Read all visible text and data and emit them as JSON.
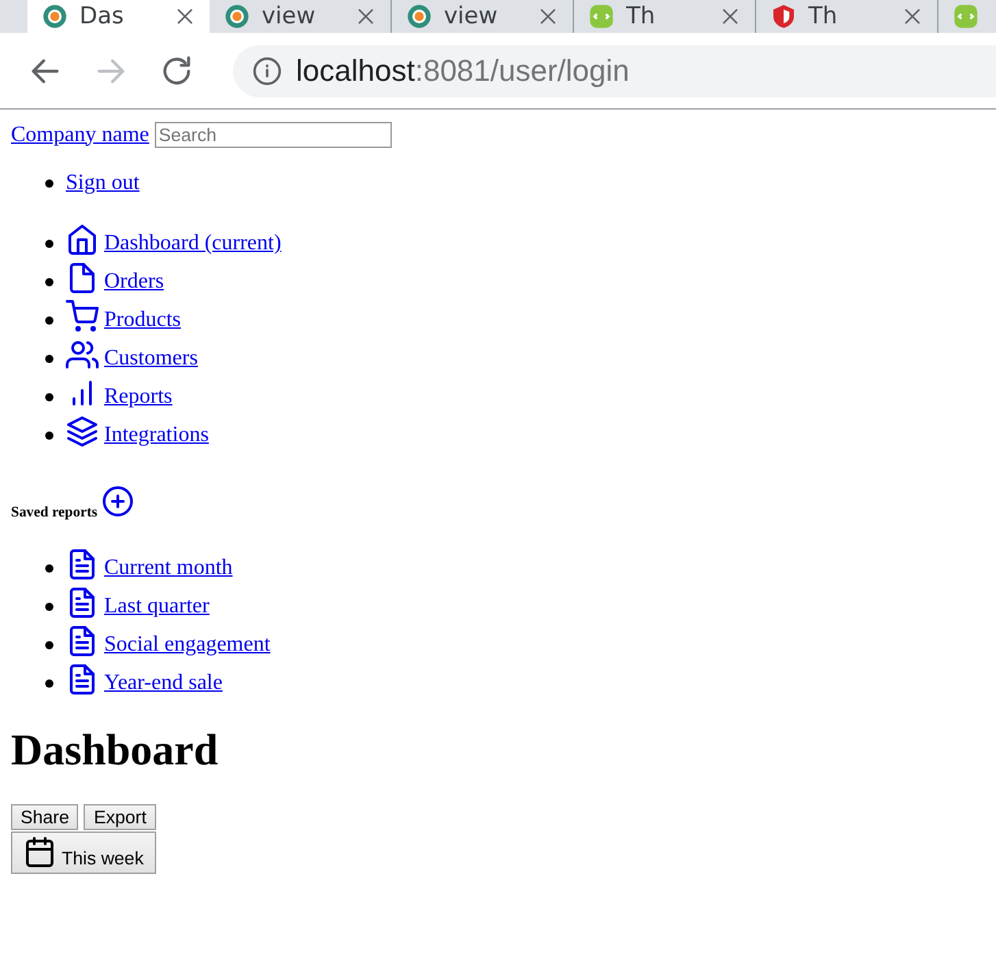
{
  "browser": {
    "tabs": [
      {
        "title": "Das",
        "selected": true
      },
      {
        "title": "view",
        "selected": false
      },
      {
        "title": "view",
        "selected": false
      },
      {
        "title": "Th",
        "selected": false
      },
      {
        "title": "Th",
        "selected": false
      },
      {
        "selected": false
      }
    ],
    "address": {
      "host": "localhost",
      "path": ":8081/user/login"
    }
  },
  "page": {
    "brand": "Company name",
    "search": {
      "placeholder": "Search"
    },
    "account_links": [
      "Sign out"
    ],
    "nav": [
      {
        "label": "Dashboard (current)"
      },
      {
        "label": "Orders"
      },
      {
        "label": "Products"
      },
      {
        "label": "Customers"
      },
      {
        "label": "Reports"
      },
      {
        "label": "Integrations"
      }
    ],
    "saved_reports_heading": "Saved reports",
    "saved_reports": [
      "Current month",
      "Last quarter",
      "Social engagement",
      "Year-end sale"
    ],
    "title": "Dashboard",
    "buttons": [
      "Share",
      "Export"
    ],
    "range_button": "This week"
  }
}
